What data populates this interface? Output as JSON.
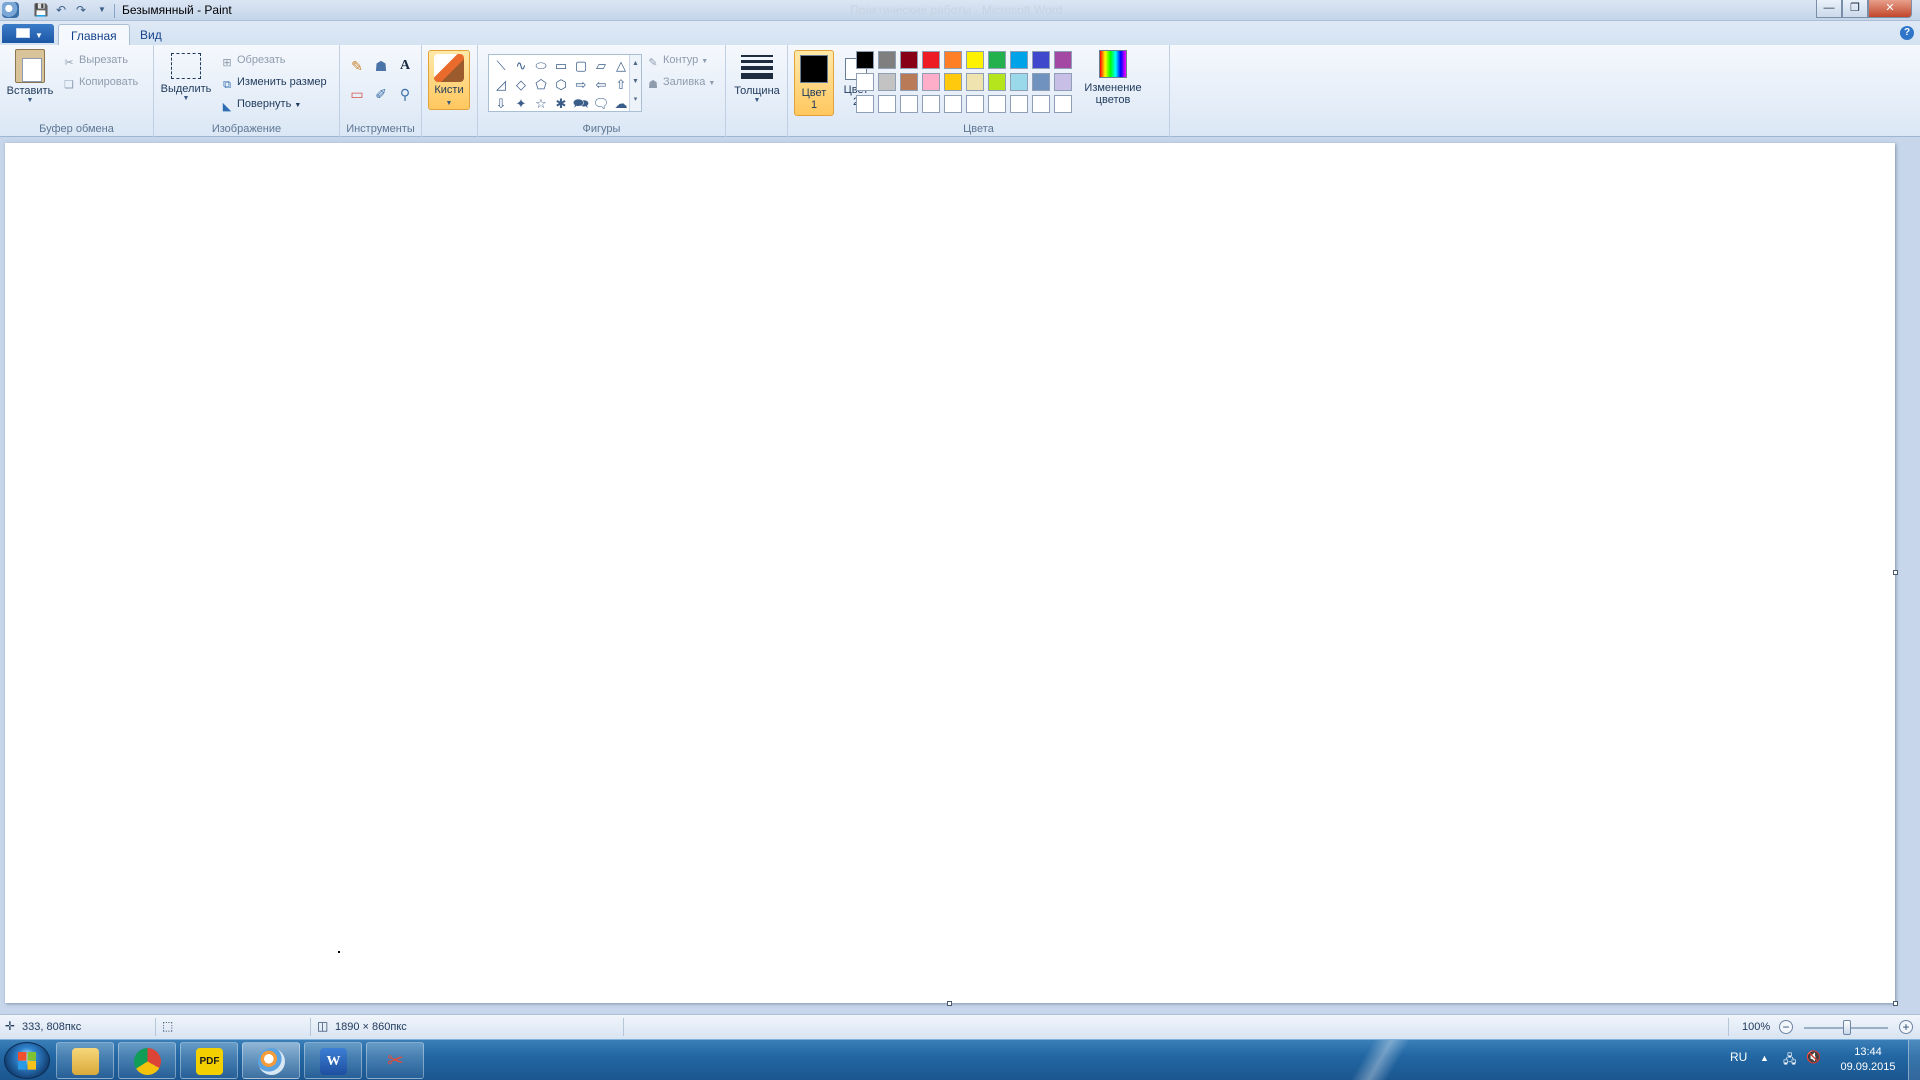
{
  "title_bar": {
    "title": "Безымянный - Paint",
    "background_window_title": "Практические работы - Microsoft Word",
    "quick_access": [
      "save-icon",
      "undo-icon",
      "redo-icon",
      "customize-icon"
    ]
  },
  "tabs": {
    "home": "Главная",
    "view": "Вид"
  },
  "ribbon": {
    "clipboard": {
      "label": "Буфер обмена",
      "paste": "Вставить",
      "cut": "Вырезать",
      "copy": "Копировать"
    },
    "image": {
      "label": "Изображение",
      "select": "Выделить",
      "crop": "Обрезать",
      "resize": "Изменить размер",
      "rotate": "Повернуть"
    },
    "tools": {
      "label": "Инструменты"
    },
    "brushes": {
      "label": "Кисти"
    },
    "shapes": {
      "label": "Фигуры",
      "outline": "Контур",
      "fill": "Заливка"
    },
    "size": {
      "label": "Толщина"
    },
    "colors": {
      "label": "Цвета",
      "color1_line1": "Цвет",
      "color1_line2": "1",
      "color2_line1": "Цвет",
      "color2_line2": "2",
      "color1": "#000000",
      "color2": "#ffffff",
      "edit_line1": "Изменение",
      "edit_line2": "цветов",
      "palette": [
        "#000000",
        "#7f7f7f",
        "#880015",
        "#ed1c24",
        "#ff7f27",
        "#fff200",
        "#22b14c",
        "#00a2e8",
        "#3f48cc",
        "#a349a4",
        "#ffffff",
        "#c3c3c3",
        "#b97a57",
        "#ffaec9",
        "#ffc90e",
        "#efe4b0",
        "#b5e61d",
        "#99d9ea",
        "#7092be",
        "#c8bfe7",
        "#ffffff",
        "#ffffff",
        "#ffffff",
        "#ffffff",
        "#ffffff",
        "#ffffff",
        "#ffffff",
        "#ffffff",
        "#ffffff",
        "#ffffff"
      ]
    }
  },
  "status": {
    "cursor": "333, 808пкс",
    "canvas_size": "1890 × 860пкс",
    "zoom": "100%"
  },
  "taskbar": {
    "apps": [
      "explorer-icon",
      "chrome-icon",
      "pdf-icon",
      "paint-icon",
      "word-icon",
      "snipping-tool-icon"
    ],
    "lang": "RU",
    "time": "13:44",
    "date": "09.09.2015"
  }
}
